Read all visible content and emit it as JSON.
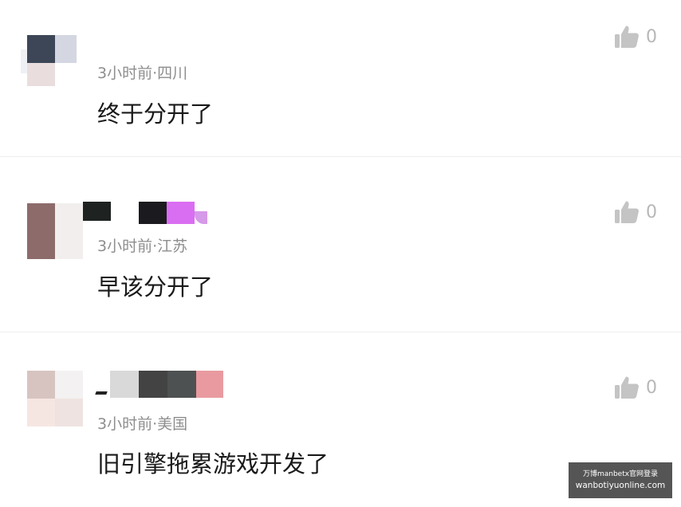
{
  "comments": [
    {
      "time": "3小时前",
      "sep": "·",
      "location": "四川",
      "text": "终于分开了",
      "likes": "0"
    },
    {
      "time": "3小时前",
      "sep": "·",
      "location": "江苏",
      "text": "早该分开了",
      "likes": "0"
    },
    {
      "time": "3小时前",
      "sep": "·",
      "location": "美国",
      "text": "旧引擎拖累游戏开发了",
      "likes": "0"
    }
  ],
  "icons": {
    "like": "thumbs-up-icon"
  },
  "colors": {
    "meta_text": "#8e8e8e",
    "content_text": "#1a1a1a",
    "like_icon": "#c4c4c4",
    "divider": "#eeeeee"
  },
  "watermark": {
    "line1": "万博manbetx官网登录",
    "line2": "wanbotiyuonline.com"
  }
}
